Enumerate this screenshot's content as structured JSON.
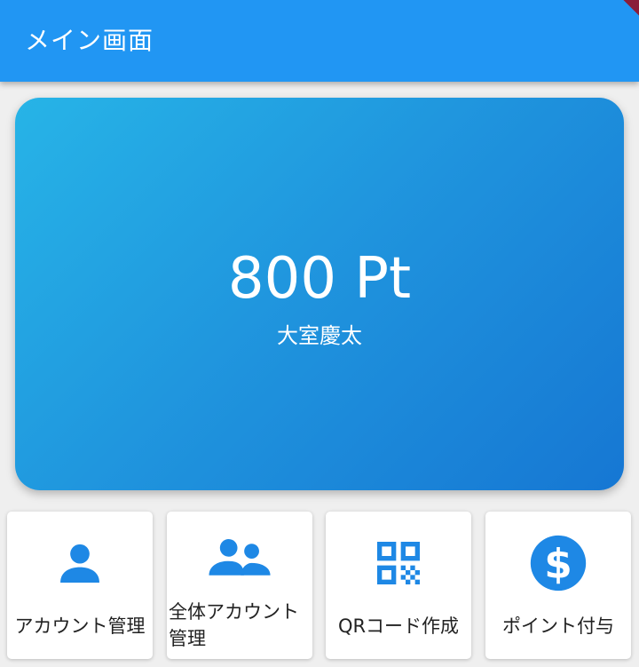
{
  "appbar": {
    "title": "メイン画面"
  },
  "points_card": {
    "value": "800 Pt",
    "owner_name": "大室慶太"
  },
  "menu": [
    {
      "label": "アカウント管理",
      "icon": "person-icon"
    },
    {
      "label_line1": "全体アカウント",
      "label_line2": "管理",
      "icon": "people-icon"
    },
    {
      "label": "QRコード作成",
      "icon": "qr-code-icon"
    },
    {
      "label": "ポイント付与",
      "icon": "dollar-circle-icon"
    }
  ],
  "colors": {
    "appbar": "#2196f3",
    "icon": "#1e88e5",
    "card_gradient_start": "#27b4e7",
    "card_gradient_end": "#1677d3",
    "debug_banner": "#8a1e3a"
  }
}
